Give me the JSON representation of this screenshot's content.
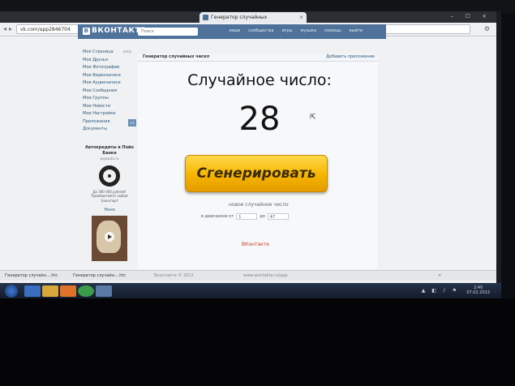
{
  "browser": {
    "tab_title": "Генератор случайных",
    "tab_close": "×",
    "url": "vk.com/app2846704",
    "window_controls": "– ☐ ×"
  },
  "vk": {
    "logo": "ВКОНТАКТЕ",
    "logo_letter": "В",
    "search_placeholder": "Поиск",
    "menu": [
      "люди",
      "сообщества",
      "игры",
      "музыка",
      "помощь",
      "выйти"
    ],
    "left_menu": [
      {
        "label": "Моя Страница",
        "extra": "ред."
      },
      {
        "label": "Мои Друзья"
      },
      {
        "label": "Мои Фотографии"
      },
      {
        "label": "Мои Видеозаписи"
      },
      {
        "label": "Мои Аудиозаписи"
      },
      {
        "label": "Мои Сообщения"
      },
      {
        "label": "Мои Группы"
      },
      {
        "label": "Мои Новости"
      },
      {
        "label": "Мои Настройки"
      },
      {
        "label": ""
      },
      {
        "label": "Приложения",
        "badge": "+1"
      },
      {
        "label": "Документы"
      }
    ],
    "ad": {
      "title": "Автокредиты в Пойо Банке",
      "site": "pojoauto.ru",
      "text": "До 300 000 рублей! Приобретайте любой транспорт",
      "more": "Ннно"
    }
  },
  "app": {
    "name": "Генератор случайных чисел",
    "add_link": "Добавить приложение",
    "label": "Случайное число:",
    "number": "28",
    "button": "Сгенерировать",
    "new_number": "новое случайное число",
    "range_from_label": "в диапазоне от",
    "range_from": "1",
    "range_to_label": "до",
    "range_to": "47",
    "link": "ВКонтакте"
  },
  "downloads": [
    "Генератор случайн....htc",
    "Генератор случайн....htc"
  ],
  "footer": [
    "Вконтакте © 2012",
    "www.wontakte.ru/app"
  ],
  "taskbar": {
    "clock_time": "2:40",
    "clock_date": "07.02.2013",
    "icons": [
      "ie",
      "explorer",
      "media",
      "chrome",
      "app"
    ]
  }
}
